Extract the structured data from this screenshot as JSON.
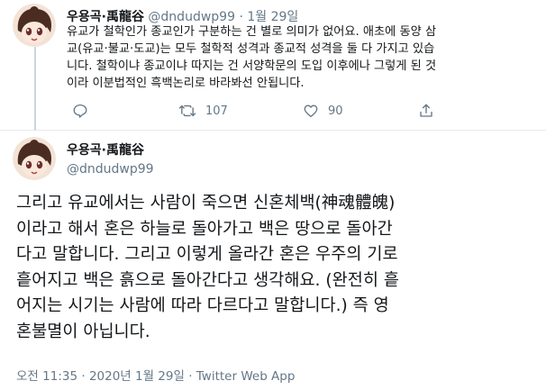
{
  "top_tweet": {
    "display_name": "우용곡·禹龍谷",
    "handle": "@dndudwp99",
    "separator": "·",
    "date": "1월 29일",
    "body_lines": [
      "유교가 철학인가 종교인가 구분하는 건 별로 의미가 없어요. 애초에 동양 삼",
      "교(유교·불교·도교)는 모두 철학적 성격과 종교적 성격을 둘 다 가지고 있습",
      "니다. 철학이냐 종교이냐 따지는 건 서양학문의 도입 이후에나 그렇게 된 것",
      "이라 이분법적인 흑백논리로 바라봐선 안됩니다."
    ],
    "retweet_count": "107",
    "like_count": "90",
    "icons": [
      "reply-icon",
      "retweet-icon",
      "like-icon",
      "share-icon"
    ]
  },
  "main_tweet": {
    "display_name": "우용곡·禹龍谷",
    "handle": "@dndudwp99",
    "body_lines": [
      "그리고 유교에서는 사람이 죽으면 신혼체백(神魂體魄)",
      "이라고 해서 혼은 하늘로 돌아가고 백은 땅으로 돌아간",
      "다고 말합니다. 그리고 이렇게 올라간 혼은 우주의 기로",
      "흩어지고 백은 흙으로 돌아간다고 생각해요. (완전히 흩",
      "어지는 시기는 사람에 따라 다르다고 말합니다.) 즉 영",
      "혼불멸이 아닙니다."
    ],
    "time": "오전 11:35",
    "separator": "·",
    "date": "2020년 1월 29일",
    "source": "Twitter Web App"
  },
  "colors": {
    "text": "#14171a",
    "muted": "#657786",
    "divider": "#e6ecf0",
    "thread_line": "#ccd6dd"
  }
}
